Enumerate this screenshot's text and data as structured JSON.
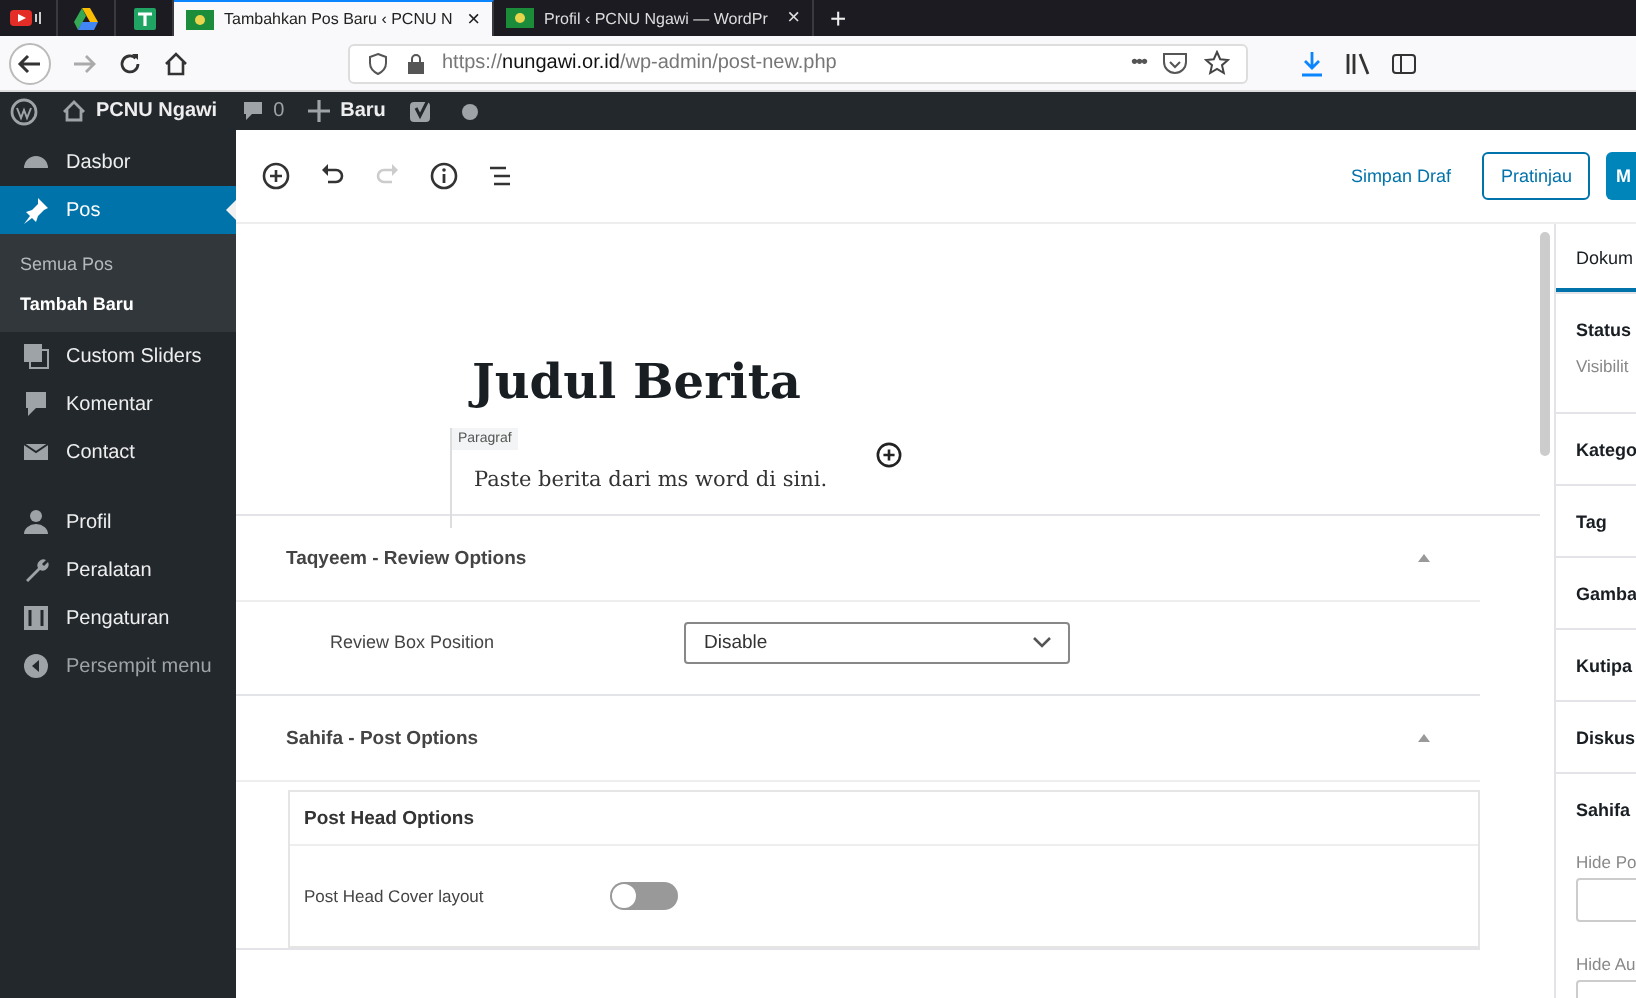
{
  "browser_tabs": [
    {
      "kind": "pinned",
      "selected": false
    },
    {
      "kind": "pinned",
      "selected": false
    },
    {
      "kind": "pinned",
      "selected": false
    },
    {
      "kind": "page",
      "title": "Tambahkan Pos Baru ‹ PCNU N",
      "close": "×",
      "selected": true
    },
    {
      "kind": "page",
      "title": "Profil ‹ PCNU Ngawi — WordPr",
      "close": "×",
      "selected": false
    }
  ],
  "new_tab": "+",
  "address_bar": {
    "scheme": "https://",
    "host": "nungawi.or.id",
    "path": "/wp-admin/post-new.php",
    "more": "•••"
  },
  "admin_bar": {
    "site": "PCNU Ngawi",
    "comments": "0",
    "new": "Baru"
  },
  "sidebar": {
    "items": [
      {
        "kind": "item",
        "label": "Dasbor",
        "selected": false
      },
      {
        "kind": "item",
        "label": "Pos",
        "selected": true
      },
      {
        "kind": "sub",
        "label": "Semua Pos",
        "selected": false
      },
      {
        "kind": "sub",
        "label": "Tambah Baru",
        "selected": true
      },
      {
        "kind": "item",
        "label": "Custom Sliders",
        "selected": false
      },
      {
        "kind": "item",
        "label": "Komentar",
        "selected": false
      },
      {
        "kind": "item",
        "label": "Contact",
        "selected": false
      },
      {
        "kind": "separator"
      },
      {
        "kind": "item",
        "label": "Profil",
        "selected": false
      },
      {
        "kind": "item",
        "label": "Peralatan",
        "selected": false
      },
      {
        "kind": "item",
        "label": "Pengaturan",
        "selected": false
      },
      {
        "kind": "collapse",
        "label": "Persempit menu",
        "selected": false
      }
    ]
  },
  "toolbar": {
    "save_draft": "Simpan Draf",
    "preview": "Pratinjau",
    "publish": "M",
    "redo_disabled": true
  },
  "editor": {
    "title": "Judul Berita",
    "block_label": "Paragraf",
    "paragraph": "Paste berita dari ms word di sini."
  },
  "meta_boxes": [
    {
      "title": "Taqyeem - Review Options",
      "expanded": true,
      "fields": [
        {
          "kind": "select",
          "label": "Review Box Position",
          "value": "Disable"
        }
      ]
    },
    {
      "title": "Sahifa - Post Options",
      "expanded": true,
      "groups": [
        {
          "title": "Post Head Options",
          "fields": [
            {
              "kind": "toggle",
              "label": "Post Head Cover layout",
              "on": false
            }
          ]
        }
      ]
    }
  ],
  "settings_sidebar": {
    "tabs": [
      {
        "label": "Dokum",
        "selected": true
      }
    ],
    "panels": [
      {
        "title": "Status",
        "rows": [
          "Visibilit"
        ]
      },
      {
        "title": "Katego"
      },
      {
        "title": "Tag"
      },
      {
        "title": "Gamba"
      },
      {
        "title": "Kutipa"
      },
      {
        "title": "Diskus"
      },
      {
        "title": "Sahifa",
        "fields": [
          "Hide Po",
          "Hide Au"
        ]
      }
    ]
  }
}
